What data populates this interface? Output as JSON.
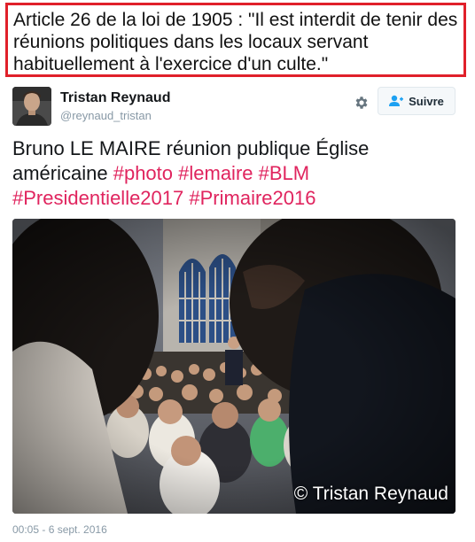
{
  "quote_box": {
    "text": "Article 26 de la loi de 1905 : \"Il est interdit de tenir des réunions politiques dans les locaux servant habituellement à l'exercice d'un culte.\"",
    "border_color": "#e0202a"
  },
  "tweet": {
    "author": {
      "name": "Tristan Reynaud",
      "handle": "@reynaud_tristan"
    },
    "settings_icon": "gear-icon",
    "follow_button": {
      "label": "Suivre",
      "icon": "add-user-icon",
      "icon_color": "#1da1f2"
    },
    "text_plain": "Bruno LE MAIRE réunion publique Église américaine ",
    "hashtags": [
      "#photo",
      "#lemaire",
      "#BLM",
      "#Presidentielle2017",
      "#Primaire2016"
    ],
    "hashtag_color": "#e0245e",
    "photo": {
      "watermark": "© Tristan Reynaud"
    },
    "timestamp": "00:05 - 6 sept. 2016"
  }
}
